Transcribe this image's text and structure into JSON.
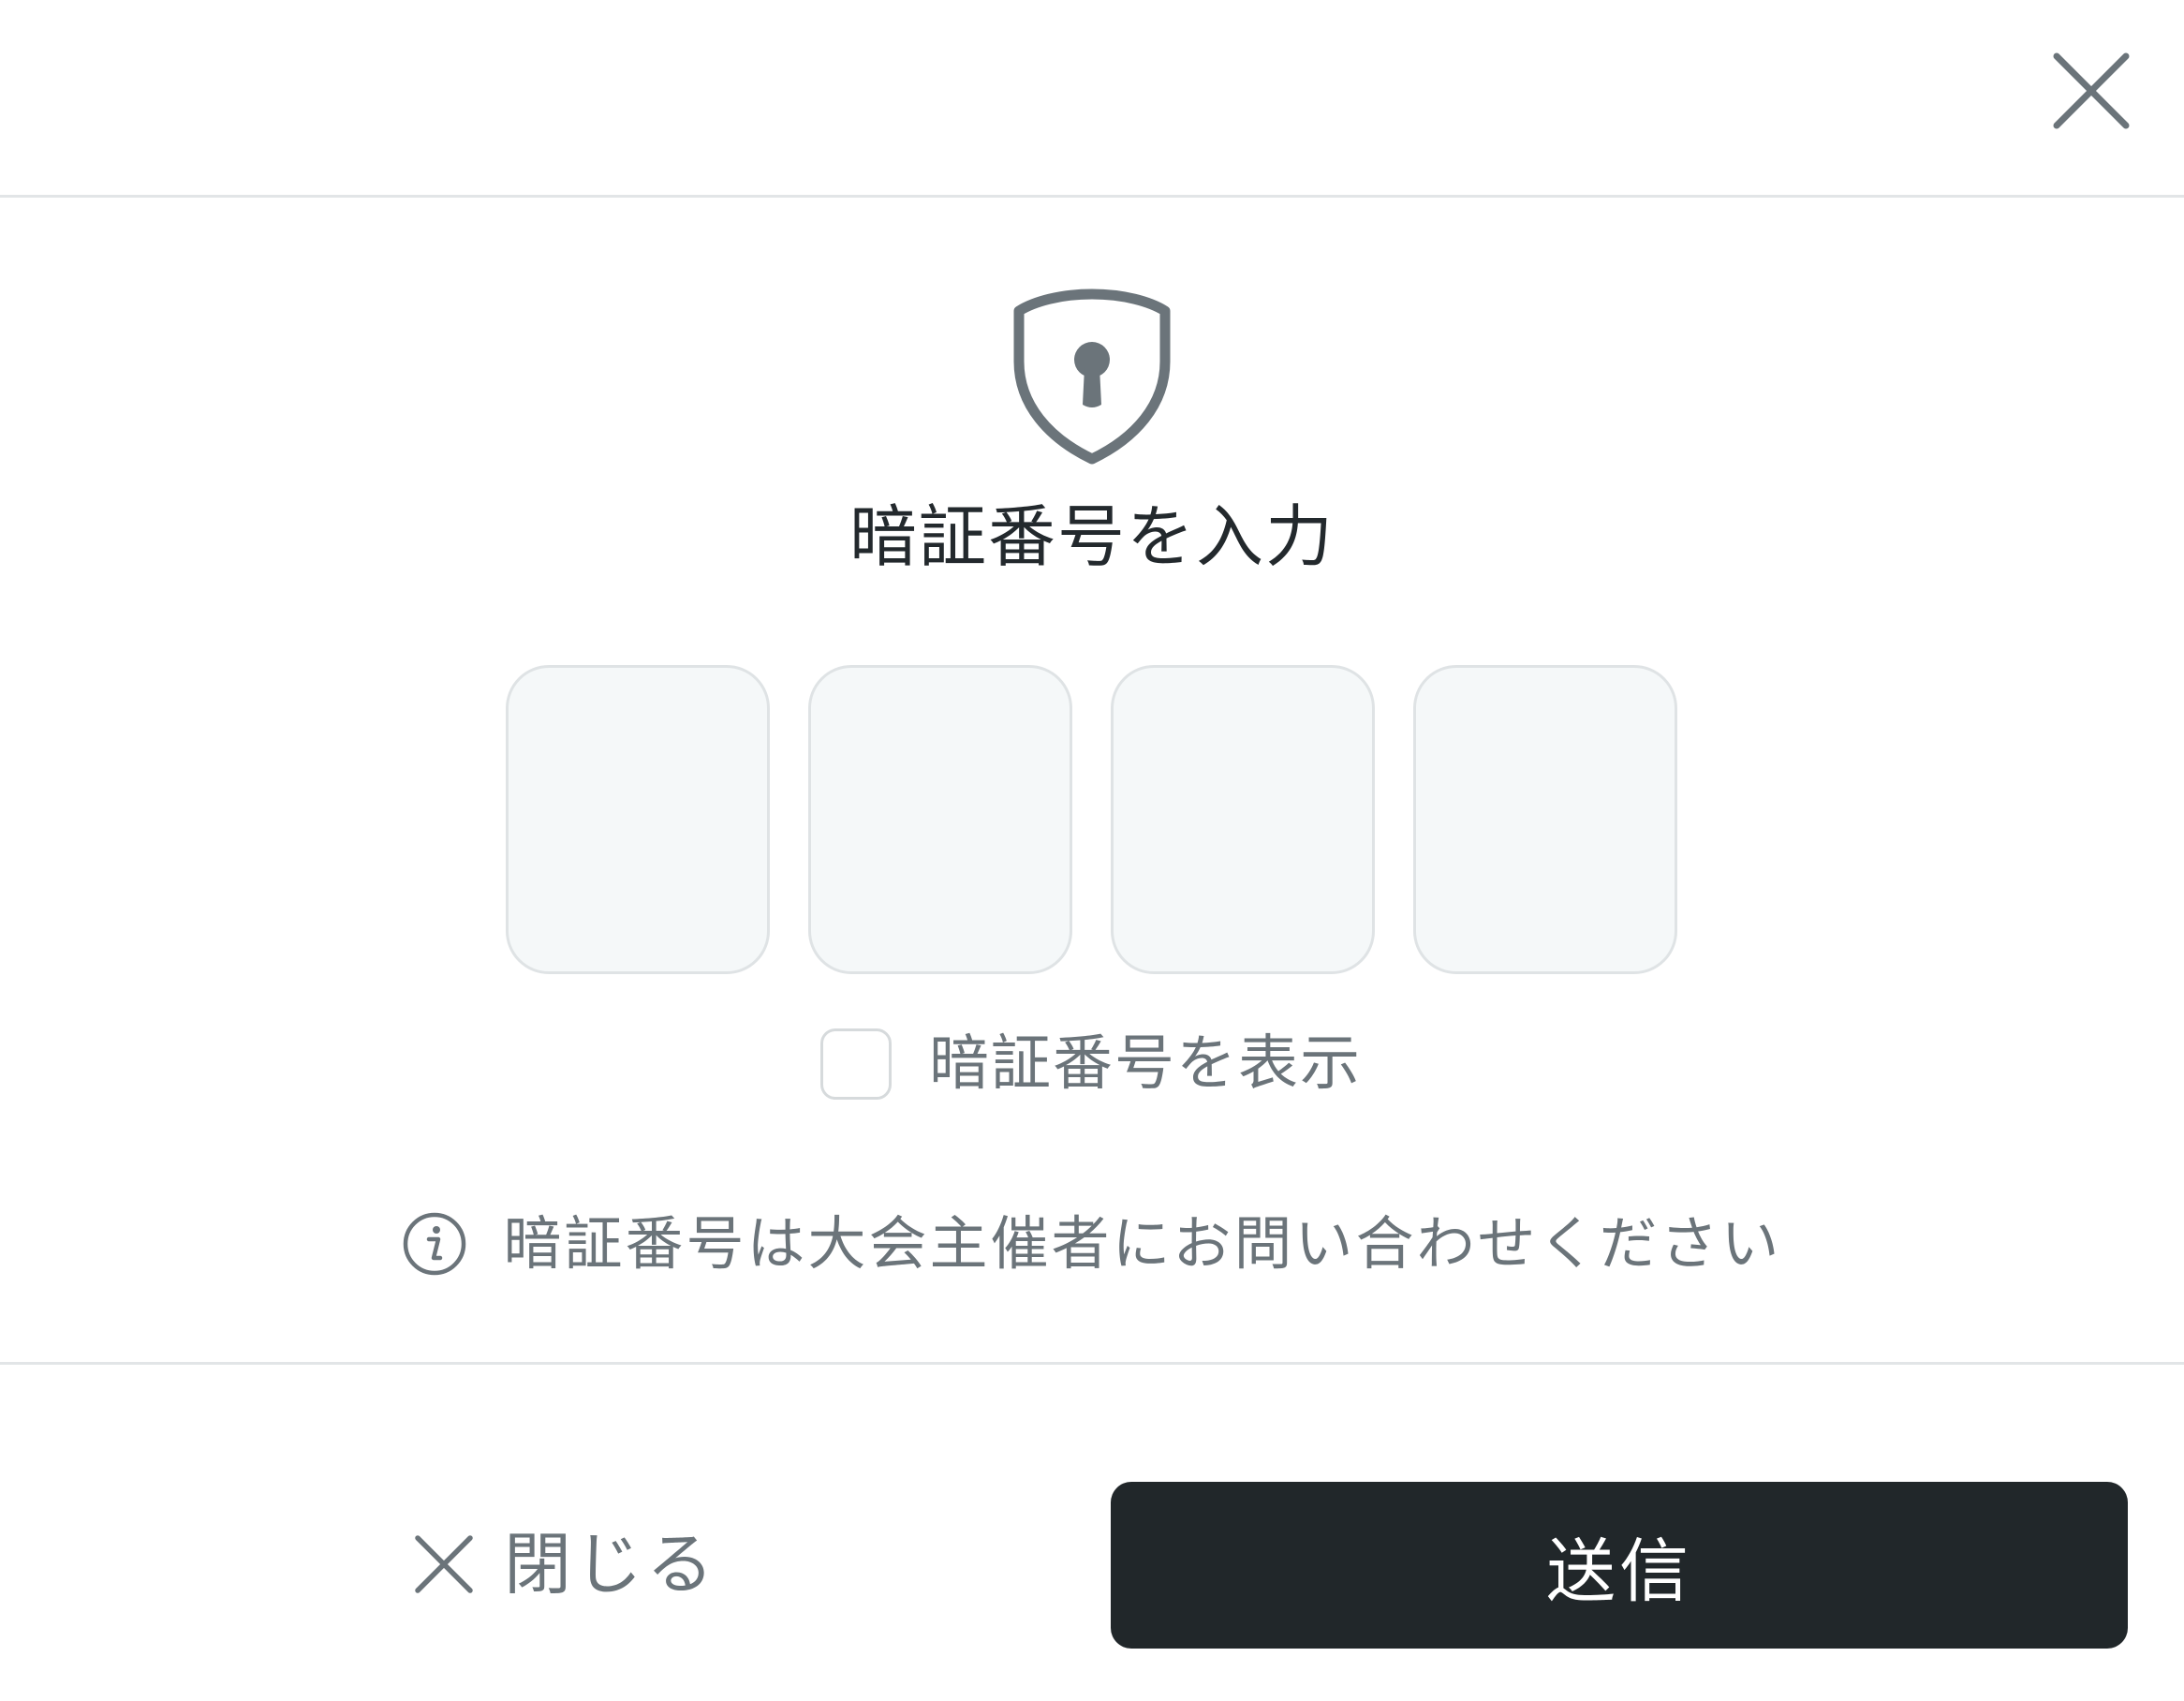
{
  "header": {
    "close_icon": "close-icon"
  },
  "pin": {
    "icon": "shield-lock-icon",
    "title": "暗証番号を入力",
    "digits": [
      "",
      "",
      "",
      ""
    ],
    "show_label": "暗証番号を表示",
    "show_checked": false
  },
  "info": {
    "icon": "info-icon",
    "text": "暗証番号は大会主催者にお問い合わせください"
  },
  "footer": {
    "close_label": "閉じる",
    "submit_label": "送信"
  },
  "colors": {
    "text_primary": "#23292d",
    "text_muted": "#6b747a",
    "icon_gray": "#6b747a",
    "divider": "#e2e5e7",
    "pin_box_bg": "#f5f8f9",
    "pin_box_border": "#dfe3e5",
    "submit_bg": "#21272a",
    "submit_text": "#ffffff"
  }
}
